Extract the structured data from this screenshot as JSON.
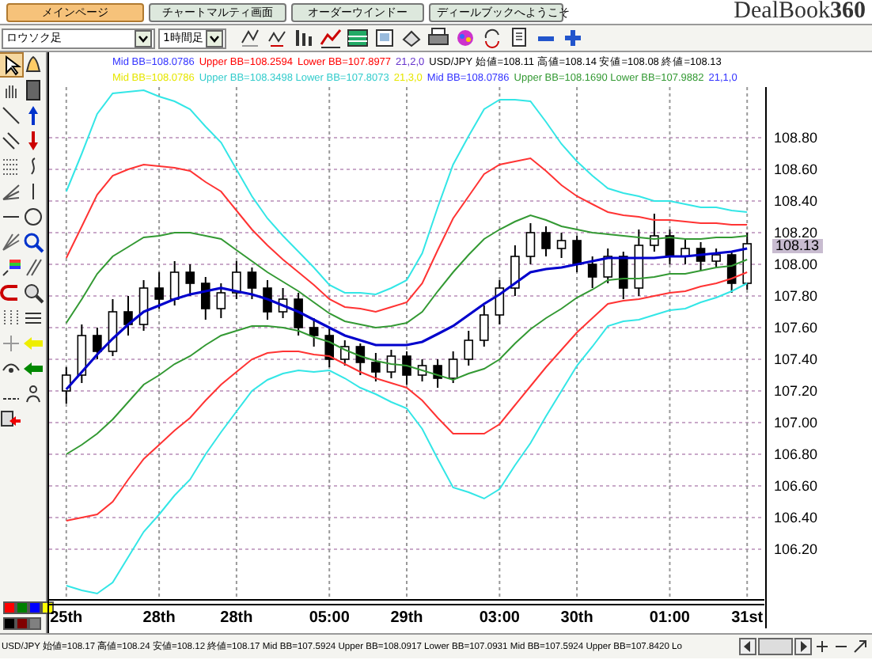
{
  "tabs": [
    {
      "label": "メインページ",
      "selected": true
    },
    {
      "label": "チャートマルティ画面",
      "selected": false
    },
    {
      "label": "オーダーウインドー",
      "selected": false
    },
    {
      "label": "ディールブックへようこそ",
      "selected": false
    }
  ],
  "logo": {
    "text": "DealBook",
    "number": "360"
  },
  "toolbar": {
    "chart_type": "ロウソク足",
    "timeframe": "1時間足"
  },
  "palette": [
    {
      "color": "#ff0000"
    },
    {
      "color": "#008000"
    },
    {
      "color": "#0000ff"
    },
    {
      "color": "#ffff00"
    },
    {
      "color": "#000000"
    },
    {
      "color": "#800000"
    },
    {
      "color": "#808080"
    }
  ],
  "chart": {
    "legend": [
      [
        {
          "text": "Mid BB=108.0786",
          "color": "#3333ff"
        },
        {
          "text": "Upper BB=108.2594",
          "color": "#ff0000"
        },
        {
          "text": "Lower BB=107.8977",
          "color": "#ff0000"
        },
        {
          "text": "21,2,0",
          "color": "#6633cc"
        },
        {
          "text": "USD/JPY 始値=108.11 高値=108.14 安値=108.08 終値=108.13",
          "color": "#000000"
        }
      ],
      [
        {
          "text": "Mid BB=108.0786",
          "color": "#e6e600"
        },
        {
          "text": "Upper BB=108.3498 Lower BB=107.8073",
          "color": "#33cccc"
        },
        {
          "text": "21,3,0",
          "color": "#e6e600"
        },
        {
          "text": "Mid BB=108.0786",
          "color": "#3333ff"
        },
        {
          "text": "Upper BB=108.1690 Lower BB=107.9882",
          "color": "#339933"
        },
        {
          "text": "21,1,0",
          "color": "#3333ff"
        }
      ]
    ],
    "current_price": "108.13",
    "chart_data": {
      "type": "candlestick",
      "grid": true,
      "categories": [
        "25th",
        null,
        null,
        null,
        null,
        null,
        "28th",
        null,
        null,
        null,
        null,
        "28th",
        null,
        null,
        null,
        null,
        null,
        "05:00",
        null,
        null,
        null,
        null,
        "29th",
        null,
        null,
        null,
        null,
        null,
        "03:00",
        null,
        null,
        null,
        null,
        "30th",
        null,
        null,
        null,
        null,
        null,
        "01:00",
        null,
        null,
        null,
        null,
        "31st"
      ],
      "ylim": [
        105.9,
        109.12
      ],
      "yticks": [
        {
          "value": 108.8,
          "label": "108.80"
        },
        {
          "value": 108.6,
          "label": "108.60"
        },
        {
          "value": 108.4,
          "label": "108.40"
        },
        {
          "value": 108.2,
          "label": "108.20"
        },
        {
          "value": 108.0,
          "label": "108.00"
        },
        {
          "value": 107.8,
          "label": "107.80"
        },
        {
          "value": 107.6,
          "label": "107.60"
        },
        {
          "value": 107.4,
          "label": "107.40"
        },
        {
          "value": 107.2,
          "label": "107.20"
        },
        {
          "value": 107.0,
          "label": "107.00"
        },
        {
          "value": 106.8,
          "label": "106.80"
        },
        {
          "value": 106.6,
          "label": "106.60"
        },
        {
          "value": 106.4,
          "label": "106.40"
        },
        {
          "value": 106.2,
          "label": "106.20"
        }
      ],
      "ohlc": [
        [
          107.2,
          107.35,
          107.12,
          107.3
        ],
        [
          107.3,
          107.62,
          107.25,
          107.55
        ],
        [
          107.55,
          107.6,
          107.4,
          107.45
        ],
        [
          107.45,
          107.78,
          107.42,
          107.7
        ],
        [
          107.7,
          107.8,
          107.55,
          107.62
        ],
        [
          107.62,
          107.9,
          107.58,
          107.85
        ],
        [
          107.85,
          107.95,
          107.72,
          107.78
        ],
        [
          107.78,
          108.02,
          107.74,
          107.95
        ],
        [
          107.95,
          108.0,
          107.8,
          107.88
        ],
        [
          107.88,
          107.92,
          107.65,
          107.72
        ],
        [
          107.72,
          107.88,
          107.66,
          107.82
        ],
        [
          107.82,
          108.02,
          107.78,
          107.95
        ],
        [
          107.95,
          107.98,
          107.78,
          107.85
        ],
        [
          107.85,
          107.9,
          107.65,
          107.7
        ],
        [
          107.7,
          107.85,
          107.66,
          107.78
        ],
        [
          107.78,
          107.82,
          107.55,
          107.6
        ],
        [
          107.6,
          107.66,
          107.48,
          107.55
        ],
        [
          107.55,
          107.6,
          107.35,
          107.4
        ],
        [
          107.4,
          107.52,
          107.36,
          107.48
        ],
        [
          107.48,
          107.5,
          107.3,
          107.38
        ],
        [
          107.38,
          107.44,
          107.26,
          107.32
        ],
        [
          107.32,
          107.46,
          107.28,
          107.42
        ],
        [
          107.42,
          107.45,
          107.24,
          107.3
        ],
        [
          107.3,
          107.4,
          107.26,
          107.36
        ],
        [
          107.36,
          107.4,
          107.22,
          107.28
        ],
        [
          107.28,
          107.45,
          107.25,
          107.4
        ],
        [
          107.4,
          107.58,
          107.36,
          107.52
        ],
        [
          107.52,
          107.74,
          107.48,
          107.68
        ],
        [
          107.68,
          107.9,
          107.62,
          107.85
        ],
        [
          107.85,
          108.12,
          107.8,
          108.05
        ],
        [
          108.05,
          108.26,
          108.0,
          108.2
        ],
        [
          108.2,
          108.24,
          108.05,
          108.1
        ],
        [
          108.1,
          108.2,
          108.04,
          108.15
        ],
        [
          108.15,
          108.18,
          107.95,
          108.0
        ],
        [
          108.0,
          108.05,
          107.85,
          107.92
        ],
        [
          107.92,
          108.1,
          107.88,
          108.05
        ],
        [
          108.05,
          108.08,
          107.78,
          107.85
        ],
        [
          107.85,
          108.22,
          107.8,
          108.12
        ],
        [
          108.12,
          108.32,
          108.08,
          108.18
        ],
        [
          108.18,
          108.22,
          108.0,
          108.05
        ],
        [
          108.05,
          108.16,
          108.0,
          108.1
        ],
        [
          108.1,
          108.14,
          107.96,
          108.02
        ],
        [
          108.02,
          108.1,
          107.98,
          108.06
        ],
        [
          108.06,
          108.08,
          107.82,
          107.88
        ],
        [
          107.88,
          108.2,
          107.84,
          108.13
        ]
      ],
      "series": [
        {
          "type": "line",
          "color": "#33e6e6",
          "values": [
            108.46,
            108.7,
            108.95,
            109.08,
            109.09,
            109.1,
            109.06,
            109.03,
            108.98,
            108.87,
            108.77,
            108.6,
            108.43,
            108.29,
            108.18,
            108.08,
            107.98,
            107.87,
            107.82,
            107.82,
            107.81,
            107.85,
            107.9,
            108.07,
            108.36,
            108.63,
            108.81,
            108.98,
            109.04,
            109.04,
            109.03,
            108.9,
            108.76,
            108.65,
            108.56,
            108.48,
            108.45,
            108.43,
            108.4,
            108.4,
            108.38,
            108.36,
            108.36,
            108.34,
            108.33
          ]
        },
        {
          "type": "line",
          "color": "#ff3333",
          "values": [
            108.04,
            108.24,
            108.44,
            108.56,
            108.6,
            108.63,
            108.62,
            108.61,
            108.59,
            108.52,
            108.46,
            108.34,
            108.22,
            108.12,
            108.03,
            107.95,
            107.87,
            107.78,
            107.73,
            107.72,
            107.7,
            107.73,
            107.76,
            107.88,
            108.09,
            108.29,
            108.43,
            108.57,
            108.63,
            108.65,
            108.67,
            108.59,
            108.5,
            108.43,
            108.38,
            108.33,
            108.31,
            108.3,
            108.28,
            108.28,
            108.27,
            108.26,
            108.26,
            108.25,
            108.25
          ]
        },
        {
          "type": "line",
          "color": "#339933",
          "values": [
            107.63,
            107.78,
            107.94,
            108.05,
            108.11,
            108.17,
            108.18,
            108.2,
            108.2,
            108.18,
            108.16,
            108.09,
            108.02,
            107.95,
            107.89,
            107.83,
            107.76,
            107.69,
            107.64,
            107.62,
            107.6,
            107.61,
            107.63,
            107.7,
            107.83,
            107.95,
            108.06,
            108.16,
            108.22,
            108.27,
            108.31,
            108.28,
            108.24,
            108.22,
            108.2,
            108.19,
            108.18,
            108.17,
            108.16,
            108.17,
            108.16,
            108.16,
            108.17,
            108.17,
            108.18
          ]
        },
        {
          "type": "line",
          "color": "#0000cc",
          "values": [
            107.21,
            107.32,
            107.43,
            107.53,
            107.62,
            107.7,
            107.74,
            107.78,
            107.81,
            107.83,
            107.85,
            107.83,
            107.81,
            107.78,
            107.74,
            107.7,
            107.65,
            107.6,
            107.55,
            107.52,
            107.49,
            107.49,
            107.49,
            107.51,
            107.56,
            107.61,
            107.68,
            107.75,
            107.81,
            107.88,
            107.95,
            107.97,
            107.98,
            108.0,
            108.02,
            108.04,
            108.04,
            108.04,
            108.04,
            108.05,
            108.05,
            108.06,
            108.07,
            108.08,
            108.1
          ]
        },
        {
          "type": "line",
          "color": "#339933",
          "values": [
            106.8,
            106.86,
            106.93,
            107.02,
            107.13,
            107.24,
            107.3,
            107.37,
            107.42,
            107.49,
            107.55,
            107.58,
            107.61,
            107.61,
            107.6,
            107.58,
            107.54,
            107.51,
            107.46,
            107.42,
            107.39,
            107.37,
            107.36,
            107.33,
            107.3,
            107.27,
            107.31,
            107.34,
            107.4,
            107.5,
            107.59,
            107.66,
            107.72,
            107.79,
            107.84,
            107.9,
            107.91,
            107.91,
            107.92,
            107.94,
            107.94,
            107.96,
            107.98,
            107.99,
            108.03
          ]
        },
        {
          "type": "line",
          "color": "#ff3333",
          "values": [
            106.38,
            106.4,
            106.42,
            106.5,
            106.64,
            106.77,
            106.86,
            106.95,
            107.03,
            107.14,
            107.24,
            107.32,
            107.4,
            107.44,
            107.45,
            107.45,
            107.43,
            107.42,
            107.37,
            107.32,
            107.28,
            107.25,
            107.22,
            107.14,
            107.03,
            106.93,
            106.93,
            106.93,
            106.99,
            107.11,
            107.23,
            107.35,
            107.46,
            107.57,
            107.66,
            107.75,
            107.77,
            107.78,
            107.8,
            107.82,
            107.83,
            107.86,
            107.88,
            107.91,
            107.95
          ]
        },
        {
          "type": "line",
          "color": "#33e6e6",
          "values": [
            105.97,
            105.94,
            105.92,
            105.99,
            106.15,
            106.31,
            106.42,
            106.54,
            106.64,
            106.8,
            106.94,
            107.07,
            107.2,
            107.27,
            107.31,
            107.33,
            107.32,
            107.33,
            107.28,
            107.22,
            107.18,
            107.13,
            107.09,
            106.96,
            106.77,
            106.59,
            106.56,
            106.52,
            106.58,
            106.73,
            106.87,
            107.04,
            107.2,
            107.36,
            107.48,
            107.61,
            107.64,
            107.65,
            107.68,
            107.71,
            107.72,
            107.76,
            107.79,
            107.83,
            107.88
          ]
        }
      ]
    }
  },
  "status_bar": {
    "text": "USD/JPY 始値=108.17 高値=108.24 安値=108.12 終値=108.17 Mid BB=107.5924 Upper BB=108.0917 Lower BB=107.0931 Mid BB=107.5924 Upper BB=107.8420 Lo"
  }
}
